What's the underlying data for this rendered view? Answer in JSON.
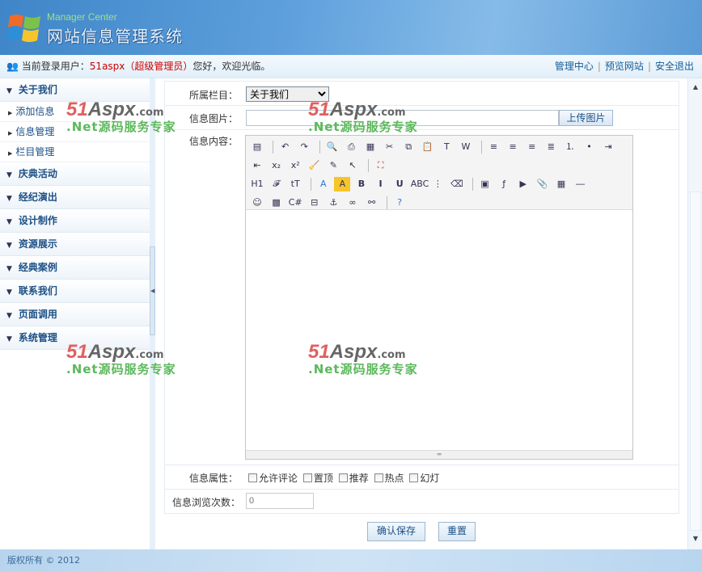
{
  "header": {
    "subtitle": "Manager Center",
    "title": "网站信息管理系统"
  },
  "userbar": {
    "prefix": "当前登录用户：",
    "username": "51aspx（超级管理员）",
    "greeting": "您好，欢迎光临。",
    "links": [
      "管理中心",
      "预览网站",
      "安全退出"
    ]
  },
  "sidebar": {
    "categories": [
      {
        "label": "关于我们",
        "items": [
          "添加信息",
          "信息管理",
          "栏目管理"
        ]
      },
      {
        "label": "庆典活动"
      },
      {
        "label": "经纪演出"
      },
      {
        "label": "设计制作"
      },
      {
        "label": "资源展示"
      },
      {
        "label": "经典案例"
      },
      {
        "label": "联系我们"
      },
      {
        "label": "页面调用"
      },
      {
        "label": "系统管理"
      }
    ]
  },
  "form": {
    "category_label": "所属栏目：",
    "category_value": "关于我们",
    "image_label": "信息图片：",
    "image_value": "",
    "upload_button": "上传图片",
    "content_label": "信息内容：",
    "attr_label": "信息属性：",
    "attrs": [
      "允许评论",
      "置顶",
      "推荐",
      "热点",
      "幻灯"
    ],
    "views_label": "信息浏览次数：",
    "views_placeholder": "0",
    "save_button": "确认保存",
    "reset_button": "重置"
  },
  "editor_toolbar": [
    [
      "source",
      "|",
      "undo",
      "redo",
      "|",
      "preview",
      "print",
      "template",
      "cut",
      "copy",
      "paste",
      "paste-text",
      "paste-word",
      "|",
      "align-left",
      "align-center",
      "align-right",
      "justify",
      "ordered-list",
      "unordered-list",
      "indent"
    ],
    [
      "outdent",
      "subscript",
      "superscript",
      "clear-format",
      "select-all",
      "select",
      "|",
      "fullscreen"
    ],
    [
      "heading",
      "font-family",
      "font-size",
      "|",
      "text-color",
      "bg-color",
      "bold",
      "italic",
      "underline",
      "strikethrough",
      "line-height",
      "remove-format",
      "|",
      "image",
      "flash",
      "media",
      "attachment",
      "table",
      "horizontal-rule"
    ],
    [
      "emoticon",
      "image-gallery",
      "code",
      "page-break",
      "anchor",
      "link",
      "unlink",
      "|",
      "help"
    ]
  ],
  "watermark": {
    "logo": "51Aspx",
    "domain": ".com",
    "slogan": ".Net源码服务专家"
  },
  "footer": {
    "copyright": "版权所有 © 2012"
  }
}
